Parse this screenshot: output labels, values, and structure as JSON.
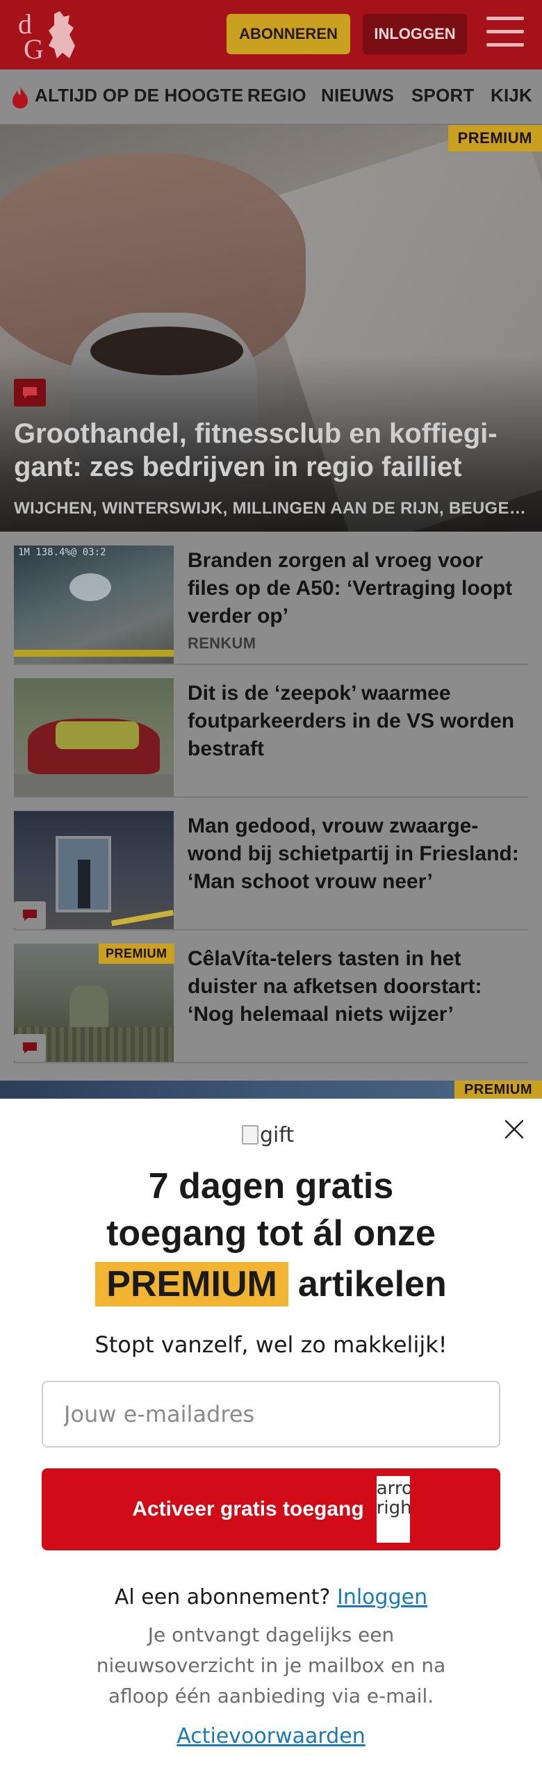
{
  "header": {
    "subscribe_label": "ABONNEREN",
    "login_label": "INLOGGEN"
  },
  "nav": {
    "items": [
      "ALTIJD OP DE HOOGTE",
      "REGIO",
      "NIEUWS",
      "SPORT",
      "KIJK"
    ]
  },
  "hero": {
    "badge": "PREMIUM",
    "title": "Groothandel, fitnessclub en koffiegi-gant: zes bedrijven in regio failliet",
    "locations": "WIJCHEN, WINTERSWIJK, MILLINGEN AAN DE RIJN, BEUGEN..."
  },
  "articles": [
    {
      "title": "Branden zorgen al vroeg voor files op de A50: ‘Vertraging loopt verder op’",
      "meta": "RENKUM",
      "badge": "",
      "thumb_caption": "1M 138.4%@ 03:2"
    },
    {
      "title": "Dit is de ‘zeepok’ waarmee foutparkeerders in de VS worden bestraft",
      "meta": "",
      "badge": ""
    },
    {
      "title": "Man gedood, vrouw zwaarge-wond bij schietpartij in Friesland: ‘Man schoot vrouw neer’",
      "meta": "",
      "badge": ""
    },
    {
      "title": "CêlaVíta-telers tasten in het duister na afketsen doorstart: ‘Nog helemaal niets wijzer’",
      "meta": "",
      "badge": "PREMIUM"
    }
  ],
  "strip_badge": "PREMIUM",
  "modal": {
    "gift_alt": "gift",
    "headline_line1": "7 dagen gratis",
    "headline_line2": "toegang tot ál onze",
    "headline_premium": "PREMIUM",
    "headline_end": "artikelen",
    "subline": "Stopt vanzelf, wel zo makkelijk!",
    "email_placeholder": "Jouw e-mailadres",
    "activate_label": "Activeer gratis toegang",
    "arrow_alt": "arrow-right",
    "already_text": "Al een abonnement?",
    "already_link": "Inloggen",
    "info_text": "Je ontvangt dagelijks een nieuwsoverzicht in je mailbox en na afloop één aanbieding via e-mail.",
    "terms_link": "Actievoorwaarden"
  },
  "colors": {
    "brand_red": "#a5121a",
    "accent_yellow": "#f2b531",
    "button_red": "#d10b17",
    "link_blue": "#1a7ab8"
  }
}
